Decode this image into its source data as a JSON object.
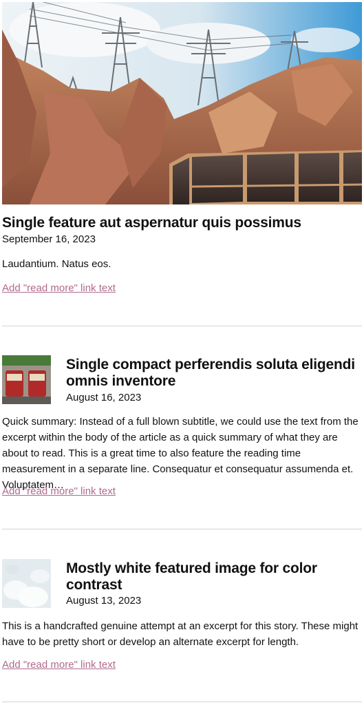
{
  "posts": [
    {
      "title": "Single feature aut aspernatur quis possimus",
      "date": "September 16, 2023",
      "excerpt": "Laudantium. Natus eos.",
      "read_more": "Add \"read more\" link text"
    },
    {
      "title": "Single compact perferendis soluta eligendi omnis inventore",
      "date": "August 16, 2023",
      "excerpt": "Quick summary: Instead of a full blown subtitle, we could use the text from the excerpt within the body of the article as a quick summary of what they are about to read. This is a great time to also feature the reading time measurement in a separate line. Consequatur et consequatur assumenda et. Voluptatem…",
      "read_more": "Add \"read more\" link text"
    },
    {
      "title": "Mostly white featured image for color contrast",
      "date": "August 13, 2023",
      "excerpt": "This is a handcrafted genuine attempt at an excerpt for this story. These might have to be pretty short or develop an alternate excerpt for length.",
      "read_more": "Add \"read more\" link text"
    }
  ],
  "colors": {
    "link": "#b06a8c",
    "divider": "#d4d4d4",
    "text": "#111111"
  }
}
